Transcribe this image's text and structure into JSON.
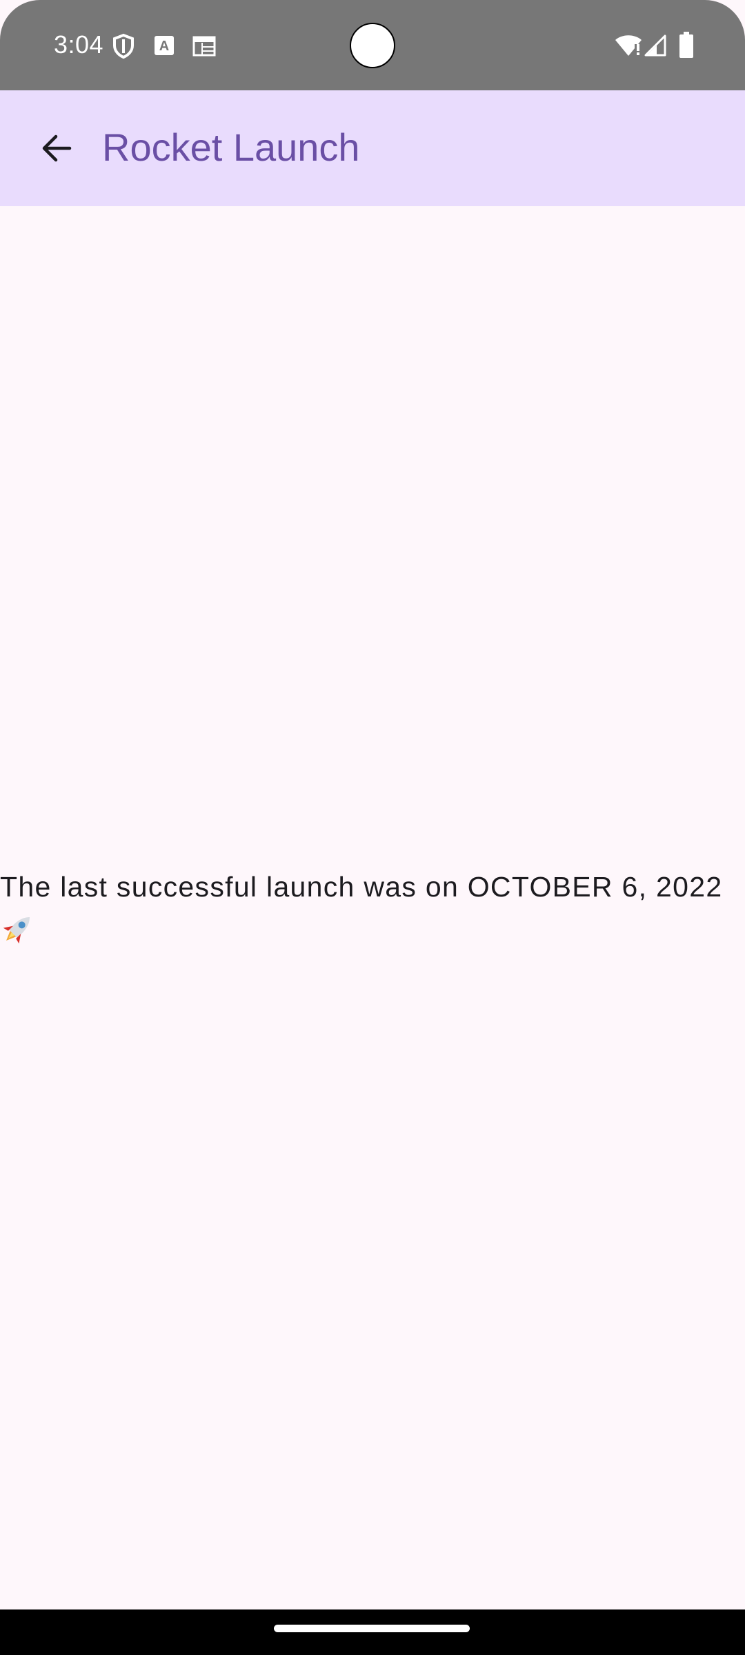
{
  "status_bar": {
    "time": "3:04",
    "left_icons": [
      "vpn-shield-icon",
      "text-a-icon",
      "calendar-icon"
    ],
    "right_icons": [
      "wifi-alert-icon",
      "cellular-signal-icon",
      "battery-icon"
    ]
  },
  "app_bar": {
    "title": "Rocket Launch",
    "back_icon": "arrow-back-icon",
    "background_color": "#e9dcfd",
    "title_color": "#6a4fa5"
  },
  "content": {
    "message": "The last successful launch was on OCTOBER 6, 2022",
    "emoji_icon": "rocket-icon",
    "background_color": "#fef7fb"
  }
}
